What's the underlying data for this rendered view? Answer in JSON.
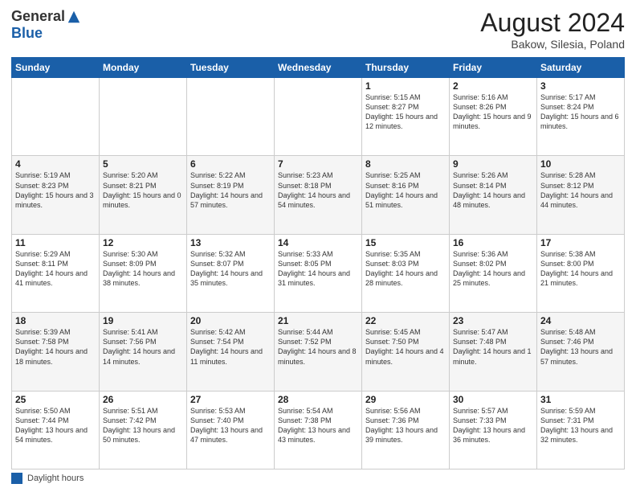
{
  "header": {
    "logo_general": "General",
    "logo_blue": "Blue",
    "month_title": "August 2024",
    "location": "Bakow, Silesia, Poland"
  },
  "days_of_week": [
    "Sunday",
    "Monday",
    "Tuesday",
    "Wednesday",
    "Thursday",
    "Friday",
    "Saturday"
  ],
  "footer_label": "Daylight hours",
  "weeks": [
    [
      {
        "day": "",
        "info": ""
      },
      {
        "day": "",
        "info": ""
      },
      {
        "day": "",
        "info": ""
      },
      {
        "day": "",
        "info": ""
      },
      {
        "day": "1",
        "info": "Sunrise: 5:15 AM\nSunset: 8:27 PM\nDaylight: 15 hours\nand 12 minutes."
      },
      {
        "day": "2",
        "info": "Sunrise: 5:16 AM\nSunset: 8:26 PM\nDaylight: 15 hours\nand 9 minutes."
      },
      {
        "day": "3",
        "info": "Sunrise: 5:17 AM\nSunset: 8:24 PM\nDaylight: 15 hours\nand 6 minutes."
      }
    ],
    [
      {
        "day": "4",
        "info": "Sunrise: 5:19 AM\nSunset: 8:23 PM\nDaylight: 15 hours\nand 3 minutes."
      },
      {
        "day": "5",
        "info": "Sunrise: 5:20 AM\nSunset: 8:21 PM\nDaylight: 15 hours\nand 0 minutes."
      },
      {
        "day": "6",
        "info": "Sunrise: 5:22 AM\nSunset: 8:19 PM\nDaylight: 14 hours\nand 57 minutes."
      },
      {
        "day": "7",
        "info": "Sunrise: 5:23 AM\nSunset: 8:18 PM\nDaylight: 14 hours\nand 54 minutes."
      },
      {
        "day": "8",
        "info": "Sunrise: 5:25 AM\nSunset: 8:16 PM\nDaylight: 14 hours\nand 51 minutes."
      },
      {
        "day": "9",
        "info": "Sunrise: 5:26 AM\nSunset: 8:14 PM\nDaylight: 14 hours\nand 48 minutes."
      },
      {
        "day": "10",
        "info": "Sunrise: 5:28 AM\nSunset: 8:12 PM\nDaylight: 14 hours\nand 44 minutes."
      }
    ],
    [
      {
        "day": "11",
        "info": "Sunrise: 5:29 AM\nSunset: 8:11 PM\nDaylight: 14 hours\nand 41 minutes."
      },
      {
        "day": "12",
        "info": "Sunrise: 5:30 AM\nSunset: 8:09 PM\nDaylight: 14 hours\nand 38 minutes."
      },
      {
        "day": "13",
        "info": "Sunrise: 5:32 AM\nSunset: 8:07 PM\nDaylight: 14 hours\nand 35 minutes."
      },
      {
        "day": "14",
        "info": "Sunrise: 5:33 AM\nSunset: 8:05 PM\nDaylight: 14 hours\nand 31 minutes."
      },
      {
        "day": "15",
        "info": "Sunrise: 5:35 AM\nSunset: 8:03 PM\nDaylight: 14 hours\nand 28 minutes."
      },
      {
        "day": "16",
        "info": "Sunrise: 5:36 AM\nSunset: 8:02 PM\nDaylight: 14 hours\nand 25 minutes."
      },
      {
        "day": "17",
        "info": "Sunrise: 5:38 AM\nSunset: 8:00 PM\nDaylight: 14 hours\nand 21 minutes."
      }
    ],
    [
      {
        "day": "18",
        "info": "Sunrise: 5:39 AM\nSunset: 7:58 PM\nDaylight: 14 hours\nand 18 minutes."
      },
      {
        "day": "19",
        "info": "Sunrise: 5:41 AM\nSunset: 7:56 PM\nDaylight: 14 hours\nand 14 minutes."
      },
      {
        "day": "20",
        "info": "Sunrise: 5:42 AM\nSunset: 7:54 PM\nDaylight: 14 hours\nand 11 minutes."
      },
      {
        "day": "21",
        "info": "Sunrise: 5:44 AM\nSunset: 7:52 PM\nDaylight: 14 hours\nand 8 minutes."
      },
      {
        "day": "22",
        "info": "Sunrise: 5:45 AM\nSunset: 7:50 PM\nDaylight: 14 hours\nand 4 minutes."
      },
      {
        "day": "23",
        "info": "Sunrise: 5:47 AM\nSunset: 7:48 PM\nDaylight: 14 hours\nand 1 minute."
      },
      {
        "day": "24",
        "info": "Sunrise: 5:48 AM\nSunset: 7:46 PM\nDaylight: 13 hours\nand 57 minutes."
      }
    ],
    [
      {
        "day": "25",
        "info": "Sunrise: 5:50 AM\nSunset: 7:44 PM\nDaylight: 13 hours\nand 54 minutes."
      },
      {
        "day": "26",
        "info": "Sunrise: 5:51 AM\nSunset: 7:42 PM\nDaylight: 13 hours\nand 50 minutes."
      },
      {
        "day": "27",
        "info": "Sunrise: 5:53 AM\nSunset: 7:40 PM\nDaylight: 13 hours\nand 47 minutes."
      },
      {
        "day": "28",
        "info": "Sunrise: 5:54 AM\nSunset: 7:38 PM\nDaylight: 13 hours\nand 43 minutes."
      },
      {
        "day": "29",
        "info": "Sunrise: 5:56 AM\nSunset: 7:36 PM\nDaylight: 13 hours\nand 39 minutes."
      },
      {
        "day": "30",
        "info": "Sunrise: 5:57 AM\nSunset: 7:33 PM\nDaylight: 13 hours\nand 36 minutes."
      },
      {
        "day": "31",
        "info": "Sunrise: 5:59 AM\nSunset: 7:31 PM\nDaylight: 13 hours\nand 32 minutes."
      }
    ]
  ]
}
